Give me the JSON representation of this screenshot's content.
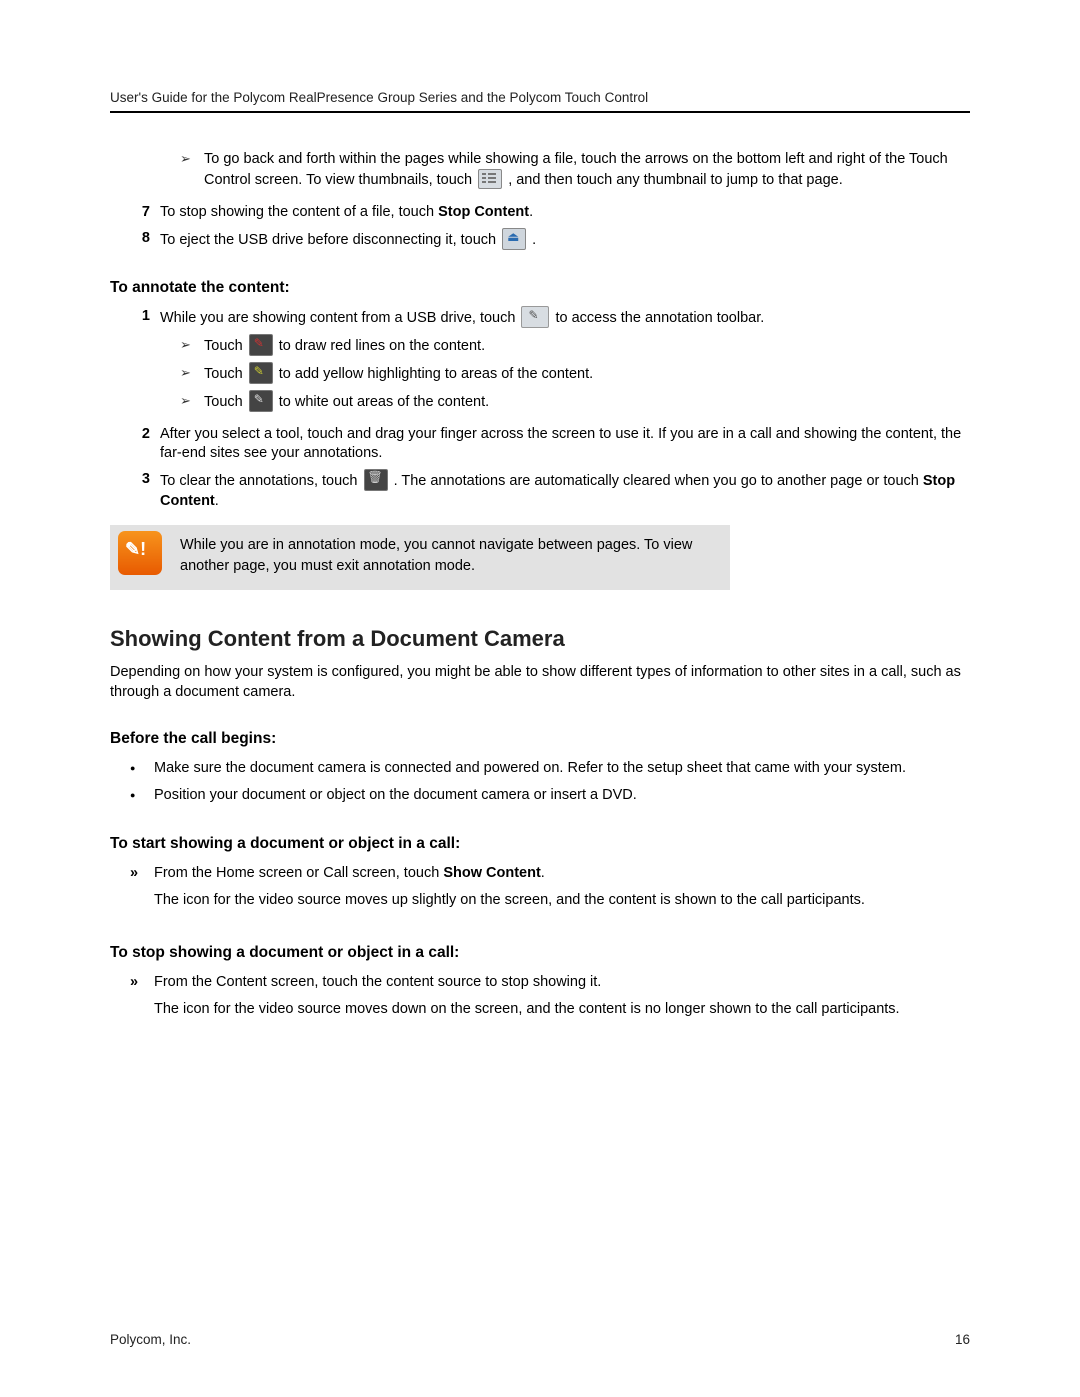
{
  "header": "User's Guide for the Polycom RealPresence Group Series and the Polycom Touch Control",
  "top_sub_item": {
    "pre": "To go back and forth within the pages while showing a file, touch the arrows on the bottom left and right of the Touch Control screen. To view thumbnails, touch ",
    "post": ", and then touch any thumbnail to jump to that page."
  },
  "step7": {
    "num": "7",
    "pre": "To stop showing the content of a file, touch ",
    "bold": "Stop Content",
    "post": "."
  },
  "step8": {
    "num": "8",
    "pre": "To eject the USB drive before disconnecting it, touch ",
    "post": "."
  },
  "annotate_heading": "To annotate the content:",
  "a1": {
    "num": "1",
    "pre": "While you are showing content from a USB drive, touch ",
    "post": " to access the annotation toolbar."
  },
  "a1_sub1": {
    "pre": "Touch ",
    "post": " to draw red lines on the content."
  },
  "a1_sub2": {
    "pre": "Touch ",
    "post": " to add yellow highlighting to areas of the content."
  },
  "a1_sub3": {
    "pre": "Touch ",
    "post": " to white out areas of the content."
  },
  "a2": {
    "num": "2",
    "text": "After you select a tool, touch and drag your finger across the screen to use it. If you are in a call and showing the content, the far-end sites see your annotations."
  },
  "a3": {
    "num": "3",
    "pre": "To clear the annotations, touch ",
    "mid": ". The annotations are automatically cleared when you go to another page or touch ",
    "bold": "Stop Content",
    "post": "."
  },
  "note": "While you are in annotation mode, you cannot navigate between pages. To view another page, you must exit annotation mode.",
  "section": "Showing Content from a Document Camera",
  "section_p": "Depending on how your system is configured, you might be able to show different types of information to other sites in a call, such as through a document camera.",
  "before_heading": "Before the call begins:",
  "before1": "Make sure the document camera is connected and powered on. Refer to the setup sheet that came with your system.",
  "before2": "Position your document or object on the document camera or insert a DVD.",
  "start_heading": "To start showing a document or object in a call:",
  "start_pre": "From the Home screen or Call screen, touch ",
  "start_bold": "Show Content",
  "start_post": ".",
  "start_para": "The icon for the video source moves up slightly on the screen, and the content is shown to the call participants.",
  "stop_heading": "To stop showing a document or object in a call:",
  "stop_item": "From the Content screen, touch the content source to stop showing it.",
  "stop_para": "The icon for the video source moves down on the screen, and the content is no longer shown to the call participants.",
  "footer_left": "Polycom, Inc.",
  "footer_right": "16"
}
